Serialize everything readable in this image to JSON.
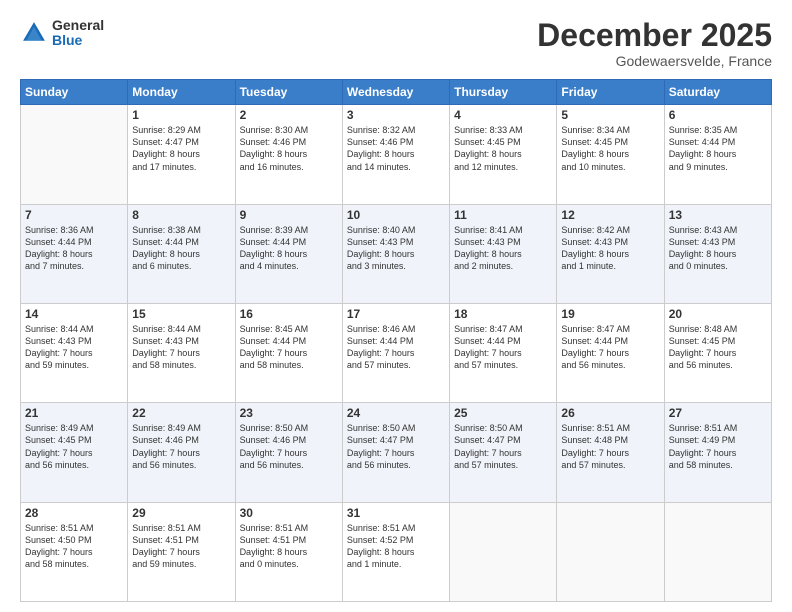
{
  "logo": {
    "general": "General",
    "blue": "Blue"
  },
  "header": {
    "month": "December 2025",
    "location": "Godewaersvelde, France"
  },
  "weekdays": [
    "Sunday",
    "Monday",
    "Tuesday",
    "Wednesday",
    "Thursday",
    "Friday",
    "Saturday"
  ],
  "weeks": [
    [
      {
        "day": "",
        "info": ""
      },
      {
        "day": "1",
        "info": "Sunrise: 8:29 AM\nSunset: 4:47 PM\nDaylight: 8 hours\nand 17 minutes."
      },
      {
        "day": "2",
        "info": "Sunrise: 8:30 AM\nSunset: 4:46 PM\nDaylight: 8 hours\nand 16 minutes."
      },
      {
        "day": "3",
        "info": "Sunrise: 8:32 AM\nSunset: 4:46 PM\nDaylight: 8 hours\nand 14 minutes."
      },
      {
        "day": "4",
        "info": "Sunrise: 8:33 AM\nSunset: 4:45 PM\nDaylight: 8 hours\nand 12 minutes."
      },
      {
        "day": "5",
        "info": "Sunrise: 8:34 AM\nSunset: 4:45 PM\nDaylight: 8 hours\nand 10 minutes."
      },
      {
        "day": "6",
        "info": "Sunrise: 8:35 AM\nSunset: 4:44 PM\nDaylight: 8 hours\nand 9 minutes."
      }
    ],
    [
      {
        "day": "7",
        "info": "Sunrise: 8:36 AM\nSunset: 4:44 PM\nDaylight: 8 hours\nand 7 minutes."
      },
      {
        "day": "8",
        "info": "Sunrise: 8:38 AM\nSunset: 4:44 PM\nDaylight: 8 hours\nand 6 minutes."
      },
      {
        "day": "9",
        "info": "Sunrise: 8:39 AM\nSunset: 4:44 PM\nDaylight: 8 hours\nand 4 minutes."
      },
      {
        "day": "10",
        "info": "Sunrise: 8:40 AM\nSunset: 4:43 PM\nDaylight: 8 hours\nand 3 minutes."
      },
      {
        "day": "11",
        "info": "Sunrise: 8:41 AM\nSunset: 4:43 PM\nDaylight: 8 hours\nand 2 minutes."
      },
      {
        "day": "12",
        "info": "Sunrise: 8:42 AM\nSunset: 4:43 PM\nDaylight: 8 hours\nand 1 minute."
      },
      {
        "day": "13",
        "info": "Sunrise: 8:43 AM\nSunset: 4:43 PM\nDaylight: 8 hours\nand 0 minutes."
      }
    ],
    [
      {
        "day": "14",
        "info": "Sunrise: 8:44 AM\nSunset: 4:43 PM\nDaylight: 7 hours\nand 59 minutes."
      },
      {
        "day": "15",
        "info": "Sunrise: 8:44 AM\nSunset: 4:43 PM\nDaylight: 7 hours\nand 58 minutes."
      },
      {
        "day": "16",
        "info": "Sunrise: 8:45 AM\nSunset: 4:44 PM\nDaylight: 7 hours\nand 58 minutes."
      },
      {
        "day": "17",
        "info": "Sunrise: 8:46 AM\nSunset: 4:44 PM\nDaylight: 7 hours\nand 57 minutes."
      },
      {
        "day": "18",
        "info": "Sunrise: 8:47 AM\nSunset: 4:44 PM\nDaylight: 7 hours\nand 57 minutes."
      },
      {
        "day": "19",
        "info": "Sunrise: 8:47 AM\nSunset: 4:44 PM\nDaylight: 7 hours\nand 56 minutes."
      },
      {
        "day": "20",
        "info": "Sunrise: 8:48 AM\nSunset: 4:45 PM\nDaylight: 7 hours\nand 56 minutes."
      }
    ],
    [
      {
        "day": "21",
        "info": "Sunrise: 8:49 AM\nSunset: 4:45 PM\nDaylight: 7 hours\nand 56 minutes."
      },
      {
        "day": "22",
        "info": "Sunrise: 8:49 AM\nSunset: 4:46 PM\nDaylight: 7 hours\nand 56 minutes."
      },
      {
        "day": "23",
        "info": "Sunrise: 8:50 AM\nSunset: 4:46 PM\nDaylight: 7 hours\nand 56 minutes."
      },
      {
        "day": "24",
        "info": "Sunrise: 8:50 AM\nSunset: 4:47 PM\nDaylight: 7 hours\nand 56 minutes."
      },
      {
        "day": "25",
        "info": "Sunrise: 8:50 AM\nSunset: 4:47 PM\nDaylight: 7 hours\nand 57 minutes."
      },
      {
        "day": "26",
        "info": "Sunrise: 8:51 AM\nSunset: 4:48 PM\nDaylight: 7 hours\nand 57 minutes."
      },
      {
        "day": "27",
        "info": "Sunrise: 8:51 AM\nSunset: 4:49 PM\nDaylight: 7 hours\nand 58 minutes."
      }
    ],
    [
      {
        "day": "28",
        "info": "Sunrise: 8:51 AM\nSunset: 4:50 PM\nDaylight: 7 hours\nand 58 minutes."
      },
      {
        "day": "29",
        "info": "Sunrise: 8:51 AM\nSunset: 4:51 PM\nDaylight: 7 hours\nand 59 minutes."
      },
      {
        "day": "30",
        "info": "Sunrise: 8:51 AM\nSunset: 4:51 PM\nDaylight: 8 hours\nand 0 minutes."
      },
      {
        "day": "31",
        "info": "Sunrise: 8:51 AM\nSunset: 4:52 PM\nDaylight: 8 hours\nand 1 minute."
      },
      {
        "day": "",
        "info": ""
      },
      {
        "day": "",
        "info": ""
      },
      {
        "day": "",
        "info": ""
      }
    ]
  ]
}
